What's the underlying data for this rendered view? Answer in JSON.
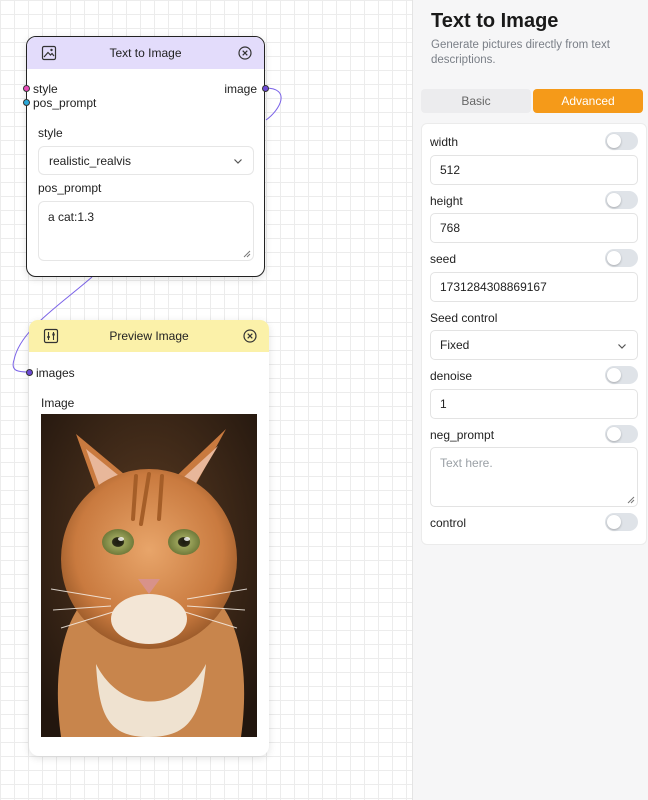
{
  "canvas": {
    "text_to_image_node": {
      "title": "Text to Image",
      "input_ports": [
        "style",
        "pos_prompt"
      ],
      "output_port": "image",
      "style_label": "style",
      "style_value": "realistic_realvis",
      "pos_prompt_label": "pos_prompt",
      "pos_prompt_value": "a cat:1.3"
    },
    "preview_node": {
      "title": "Preview Image",
      "input_port": "images",
      "image_label": "Image"
    }
  },
  "panel": {
    "title": "Text to Image",
    "description": "Generate pictures directly from text descriptions.",
    "tabs": {
      "basic": "Basic",
      "advanced": "Advanced",
      "active": "Advanced"
    },
    "fields": {
      "width": {
        "label": "width",
        "value": "512"
      },
      "height": {
        "label": "height",
        "value": "768"
      },
      "seed": {
        "label": "seed",
        "value": "1731284308869167"
      },
      "seed_control": {
        "label": "Seed control",
        "value": "Fixed"
      },
      "denoise": {
        "label": "denoise",
        "value": "1"
      },
      "neg_prompt": {
        "label": "neg_prompt",
        "placeholder": "Text here."
      },
      "control": {
        "label": "control"
      }
    }
  },
  "colors": {
    "t2i_header": "#e3dcfb",
    "preview_header": "#fbf1a9",
    "accent": "#f59a19",
    "port_style": "#e84bb8",
    "port_pos_prompt": "#29a8d8",
    "port_output": "#6c4ad6",
    "wire": "#7b63e8"
  }
}
